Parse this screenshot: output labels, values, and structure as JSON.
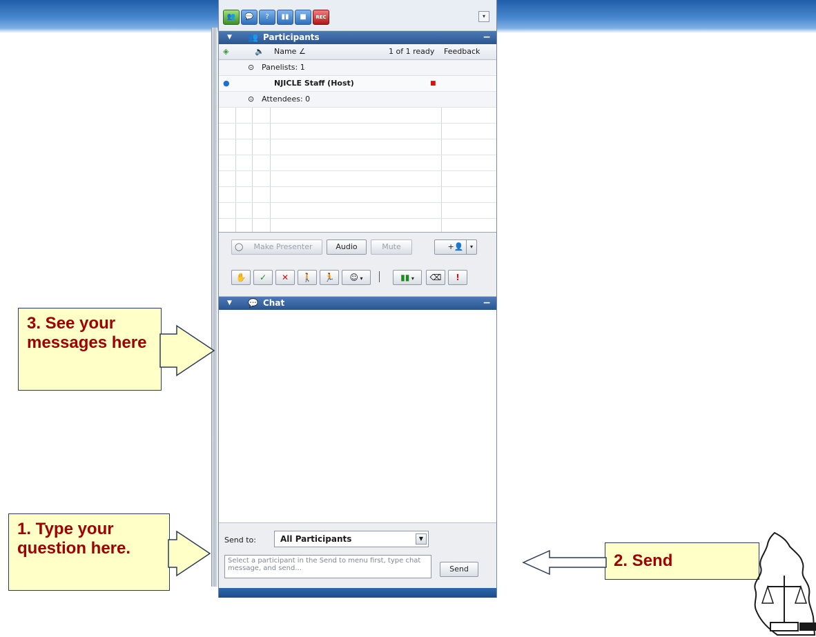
{
  "toolbar": {
    "buttons": [
      {
        "icon": "participants-icon",
        "glyph": "👥"
      },
      {
        "icon": "chat-icon",
        "glyph": "💬"
      },
      {
        "icon": "qa-icon",
        "glyph": "?"
      },
      {
        "icon": "polling-icon",
        "glyph": "▮▮"
      },
      {
        "icon": "video-icon",
        "glyph": "■"
      },
      {
        "icon": "record-icon",
        "glyph": "REC"
      }
    ],
    "menu_glyph": "▾"
  },
  "participants": {
    "title": "Participants",
    "header": {
      "name": "Name",
      "sort": "∠",
      "ready": "1 of 1 ready",
      "feedback": "Feedback"
    },
    "panelists_group": "Panelists: 1",
    "host_name": "NJICLE Staff (Host)",
    "attendees_group": "Attendees: 0"
  },
  "controls": {
    "make_presenter": "Make Presenter",
    "audio": "Audio",
    "mute": "Mute",
    "invite": "+👤",
    "feedback_icons": [
      {
        "icon": "raise-hand-icon",
        "glyph": "✋"
      },
      {
        "icon": "yes-icon",
        "glyph": "✓"
      },
      {
        "icon": "no-icon",
        "glyph": "✕"
      },
      {
        "icon": "go-slower-icon",
        "glyph": "🚶"
      },
      {
        "icon": "go-faster-icon",
        "glyph": "🏃"
      },
      {
        "icon": "emoticon-icon",
        "glyph": "☺"
      },
      {
        "icon": "chart-icon",
        "glyph": "▮▮"
      },
      {
        "icon": "eraser-icon",
        "glyph": "⌫"
      },
      {
        "icon": "alert-icon",
        "glyph": "!"
      }
    ]
  },
  "chat": {
    "title": "Chat",
    "send_to_label": "Send to:",
    "send_to_value": "All Participants",
    "input_placeholder": "Select a participant in the Send to menu first, type chat message, and send...",
    "send_button": "Send"
  },
  "callouts": {
    "see_messages": "3. See your messages here",
    "type_question": "1. Type your question here.",
    "send": "2. Send"
  },
  "colors": {
    "callout_bg": "#ffffc8",
    "callout_text": "#a00000",
    "accent": "#2a558f"
  }
}
